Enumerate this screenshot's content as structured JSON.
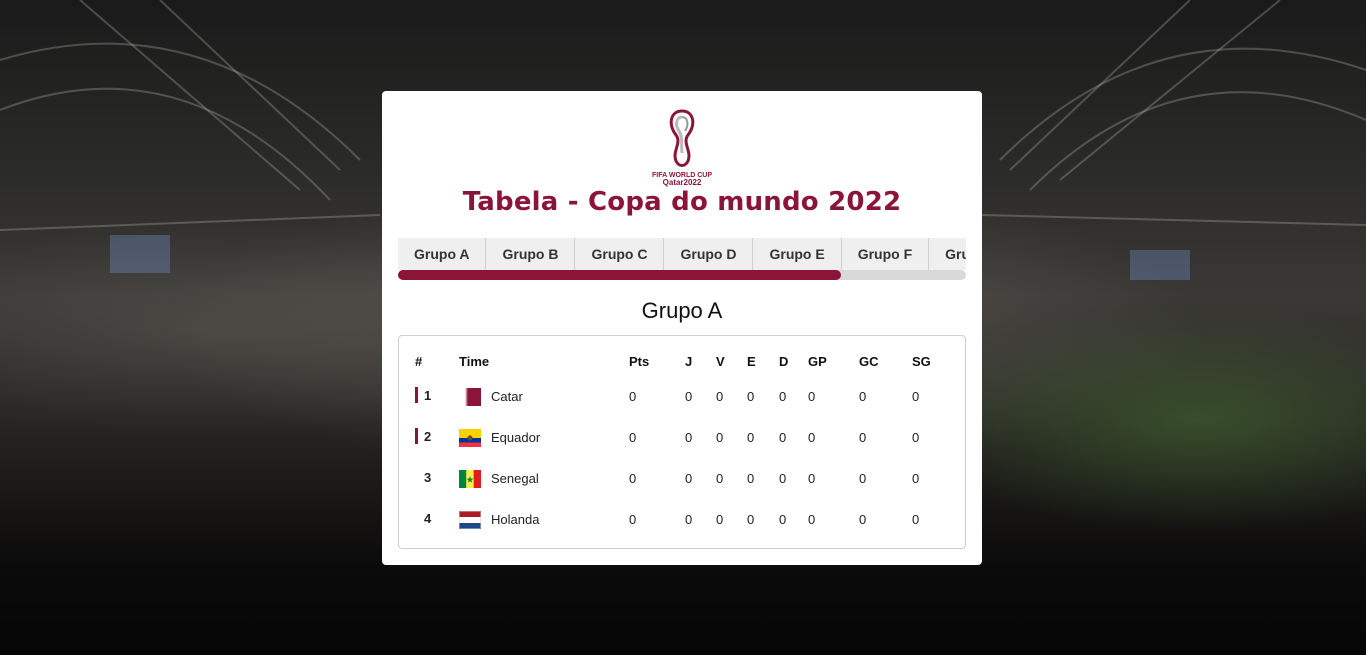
{
  "logo": {
    "line1": "FIFA WORLD CUP",
    "line2": "Qatar2022"
  },
  "title": "Tabela - Copa do mundo 2022",
  "tabs": [
    {
      "label": "Grupo A"
    },
    {
      "label": "Grupo B"
    },
    {
      "label": "Grupo C"
    },
    {
      "label": "Grupo D"
    },
    {
      "label": "Grupo E"
    },
    {
      "label": "Grupo F"
    },
    {
      "label": "Grupo G"
    }
  ],
  "scroll_fraction": 0.78,
  "group_title": "Grupo A",
  "table": {
    "headers": {
      "pos": "#",
      "team": "Time",
      "pts": "Pts",
      "j": "J",
      "v": "V",
      "e": "E",
      "d": "D",
      "gp": "GP",
      "gc": "GC",
      "sg": "SG"
    },
    "rows": [
      {
        "pos": "1",
        "team": "Catar",
        "flag": "qatar",
        "qualified": true,
        "pts": "0",
        "j": "0",
        "v": "0",
        "e": "0",
        "d": "0",
        "gp": "0",
        "gc": "0",
        "sg": "0"
      },
      {
        "pos": "2",
        "team": "Equador",
        "flag": "ecuador",
        "qualified": true,
        "pts": "0",
        "j": "0",
        "v": "0",
        "e": "0",
        "d": "0",
        "gp": "0",
        "gc": "0",
        "sg": "0"
      },
      {
        "pos": "3",
        "team": "Senegal",
        "flag": "senegal",
        "qualified": false,
        "pts": "0",
        "j": "0",
        "v": "0",
        "e": "0",
        "d": "0",
        "gp": "0",
        "gc": "0",
        "sg": "0"
      },
      {
        "pos": "4",
        "team": "Holanda",
        "flag": "netherlands",
        "qualified": false,
        "pts": "0",
        "j": "0",
        "v": "0",
        "e": "0",
        "d": "0",
        "gp": "0",
        "gc": "0",
        "sg": "0"
      }
    ]
  },
  "colors": {
    "accent": "#8a1538"
  }
}
